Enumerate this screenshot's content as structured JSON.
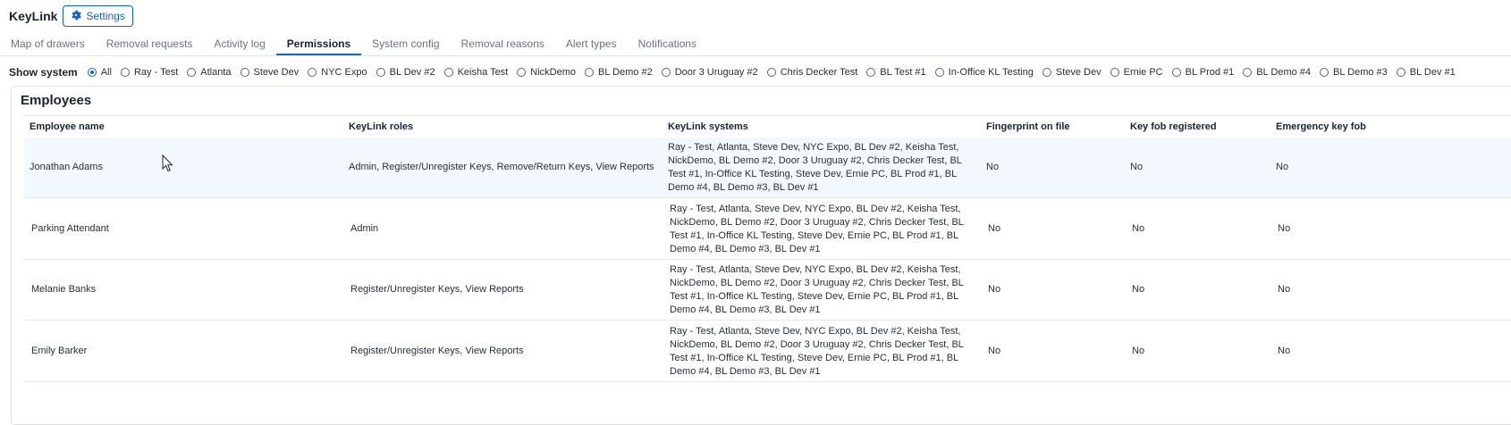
{
  "app": {
    "title": "KeyLink",
    "settings_label": "Settings"
  },
  "tabs": [
    {
      "label": "Map of drawers"
    },
    {
      "label": "Removal requests"
    },
    {
      "label": "Activity log"
    },
    {
      "label": "Permissions",
      "active": true
    },
    {
      "label": "System config"
    },
    {
      "label": "Removal reasons"
    },
    {
      "label": "Alert types"
    },
    {
      "label": "Notifications"
    }
  ],
  "system_filter": {
    "label": "Show system",
    "selected": "All",
    "options": [
      "All",
      "Ray - Test",
      "Atlanta",
      "Steve Dev",
      "NYC Expo",
      "BL Dev #2",
      "Keisha Test",
      "NickDemo",
      "BL Demo #2",
      "Door 3 Uruguay #2",
      "Chris Decker Test",
      "BL Test #1",
      "In-Office KL Testing",
      "Steve Dev",
      "Ernie PC",
      "BL Prod #1",
      "BL Demo #4",
      "BL Demo #3",
      "BL Dev #1"
    ]
  },
  "employees": {
    "title": "Employees",
    "columns": [
      "Employee name",
      "KeyLink roles",
      "KeyLink systems",
      "Fingerprint on file",
      "Key fob registered",
      "Emergency key fob"
    ],
    "rows": [
      {
        "name": "Jonathan Adams",
        "roles": "Admin, Register/Unregister Keys, Remove/Return Keys, View Reports",
        "systems": "Ray - Test, Atlanta, Steve Dev, NYC Expo, BL Dev #2, Keisha Test, NickDemo, BL Demo #2, Door 3 Uruguay #2, Chris Decker Test, BL Test #1, In-Office KL Testing, Steve Dev, Ernie PC, BL Prod #1, BL Demo #4, BL Demo #3, BL Dev #1",
        "fingerprint": "No",
        "key_fob": "No",
        "emergency_fob": "No"
      },
      {
        "name": "Parking Attendant",
        "roles": "Admin",
        "systems": "Ray - Test, Atlanta, Steve Dev, NYC Expo, BL Dev #2, Keisha Test, NickDemo, BL Demo #2, Door 3 Uruguay #2, Chris Decker Test, BL Test #1, In-Office KL Testing, Steve Dev, Ernie PC, BL Prod #1, BL Demo #4, BL Demo #3, BL Dev #1",
        "fingerprint": "No",
        "key_fob": "No",
        "emergency_fob": "No"
      },
      {
        "name": "Melanie Banks",
        "roles": "Register/Unregister Keys, View Reports",
        "systems": "Ray - Test, Atlanta, Steve Dev, NYC Expo, BL Dev #2, Keisha Test, NickDemo, BL Demo #2, Door 3 Uruguay #2, Chris Decker Test, BL Test #1, In-Office KL Testing, Steve Dev, Ernie PC, BL Prod #1, BL Demo #4, BL Demo #3, BL Dev #1",
        "fingerprint": "No",
        "key_fob": "No",
        "emergency_fob": "No"
      },
      {
        "name": "Emily Barker",
        "roles": "Register/Unregister Keys, View Reports",
        "systems": "Ray - Test, Atlanta, Steve Dev, NYC Expo, BL Dev #2, Keisha Test, NickDemo, BL Demo #2, Door 3 Uruguay #2, Chris Decker Test, BL Test #1, In-Office KL Testing, Steve Dev, Ernie PC, BL Prod #1, BL Demo #4, BL Demo #3, BL Dev #1",
        "fingerprint": "No",
        "key_fob": "No",
        "emergency_fob": "No"
      }
    ]
  },
  "colors": {
    "accent": "#1565c0",
    "row_hover": "#f2f8fd",
    "border": "#dfe3e8"
  }
}
